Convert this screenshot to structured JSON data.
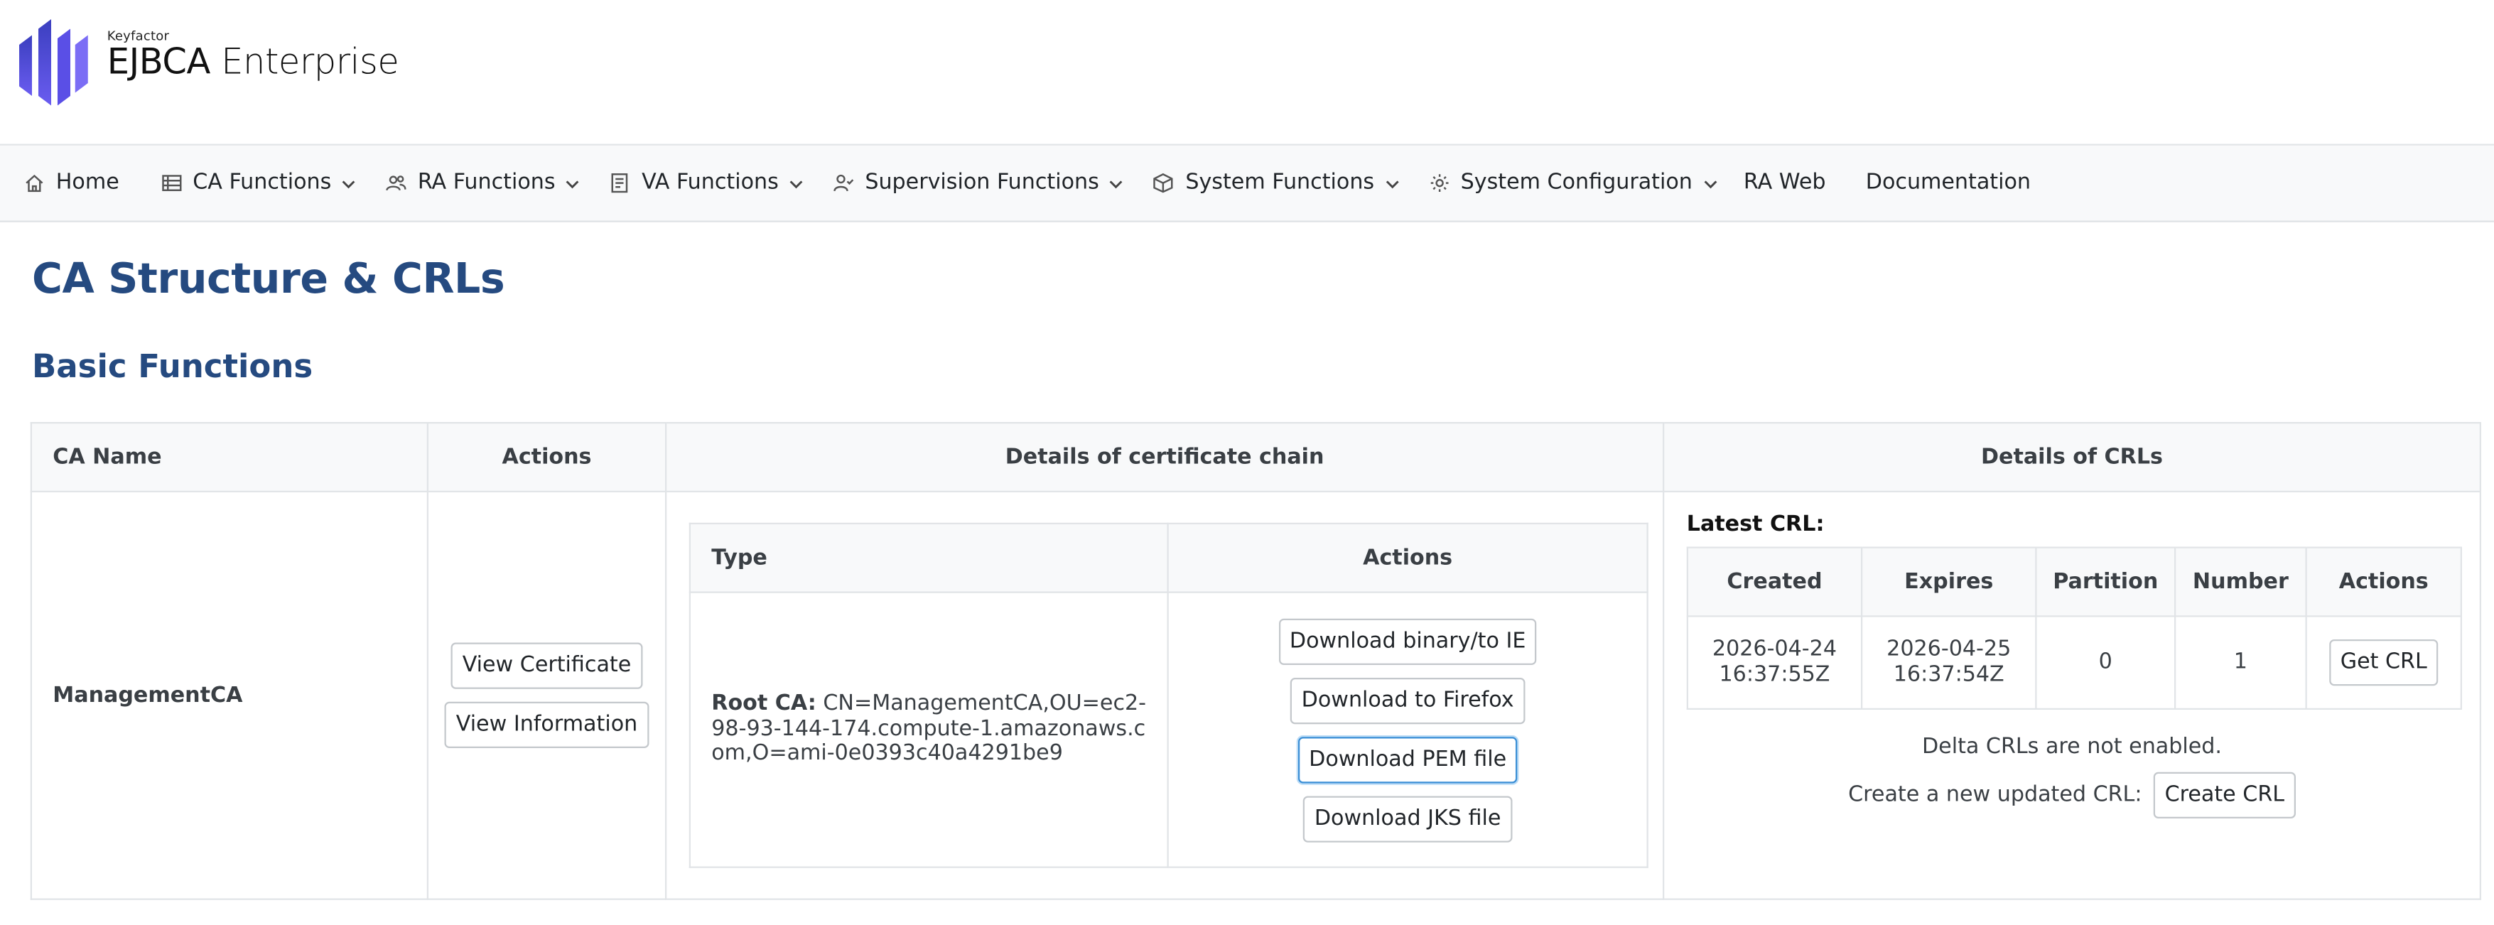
{
  "logo": {
    "brand": "Keyfactor",
    "product_bold": "EJBCA",
    "product_rest": " Enterprise",
    "color": "#5b4ee0"
  },
  "nav": {
    "items": [
      {
        "label": "Home",
        "icon": "home-icon"
      },
      {
        "label": "CA Functions",
        "icon": "list-icon",
        "dropdown": true
      },
      {
        "label": "RA Functions",
        "icon": "users-icon",
        "dropdown": true
      },
      {
        "label": "VA Functions",
        "icon": "document-icon",
        "dropdown": true
      },
      {
        "label": "Supervision Functions",
        "icon": "user-check-icon",
        "dropdown": true
      },
      {
        "label": "System Functions",
        "icon": "cube-icon",
        "dropdown": true
      },
      {
        "label": "System Configuration",
        "icon": "gear-icon",
        "dropdown": true
      },
      {
        "label": "RA Web"
      },
      {
        "label": "Documentation"
      }
    ]
  },
  "page": {
    "title": "CA Structure & CRLs",
    "section_title": "Basic Functions",
    "title_color": "#254a80"
  },
  "table": {
    "headers": {
      "ca_name": "CA Name",
      "actions": "Actions",
      "chain": "Details of certificate chain",
      "crls": "Details of CRLs"
    },
    "row": {
      "ca_name": "ManagementCA",
      "view_certificate": "View Certificate",
      "view_information": "View Information",
      "chain": {
        "headers": {
          "type": "Type",
          "actions": "Actions"
        },
        "type_label": "Root CA:",
        "type_value": " CN=ManagementCA,OU=ec2-98-93-144-174.compute-1.amazonaws.com,O=ami-0e0393c40a4291be9",
        "buttons": {
          "binary": "Download binary/to IE",
          "firefox": "Download to Firefox",
          "pem": "Download PEM file",
          "jks": "Download JKS file"
        }
      },
      "crl": {
        "latest_label": "Latest CRL:",
        "headers": {
          "created": "Created",
          "expires": "Expires",
          "partition": "Partition",
          "number": "Number",
          "actions": "Actions"
        },
        "created_date": "2026-04-24",
        "created_time": "16:37:55Z",
        "expires_date": "2026-04-25",
        "expires_time": "16:37:54Z",
        "partition": "0",
        "number": "1",
        "get_crl": "Get CRL",
        "delta_note": "Delta CRLs are not enabled.",
        "create_label": "Create a new updated CRL:",
        "create_button": "Create CRL"
      }
    }
  }
}
